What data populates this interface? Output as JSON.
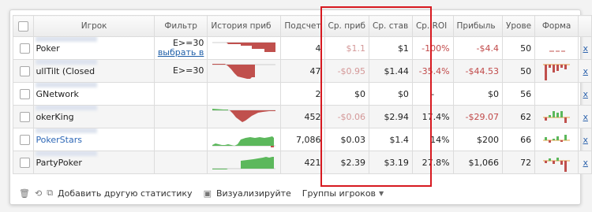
{
  "columns": {
    "player": "Игрок",
    "filter": "Фильтр",
    "history": "История приб",
    "hands": "Подсчет",
    "profit_bb": "Ср. приб",
    "avg_bet": "Ср. став",
    "avg_roi": "Ср. ROI",
    "profit": "Прибыль",
    "level": "Урове",
    "form": "Форма"
  },
  "rows": [
    {
      "player": "Poker",
      "filter_text": "E>=30",
      "filter_link": "выбрать в",
      "hands": "4",
      "profit_bb": "$1.1",
      "avg_bet": "$1",
      "avg_roi": "-100%",
      "profit": "-$4.4",
      "level": "50",
      "x": "x"
    },
    {
      "player": "ullTilt (Closed",
      "filter_text": "E>=30",
      "filter_link": "",
      "hands": "47",
      "profit_bb": "-$0.95",
      "avg_bet": "$1.44",
      "avg_roi": "-35.4%",
      "profit": "-$44.53",
      "level": "50",
      "x": "x"
    },
    {
      "player": "GNetwork",
      "filter_text": "",
      "filter_link": "",
      "hands": "2",
      "profit_bb": "$0",
      "avg_bet": "$0",
      "avg_roi": "-",
      "profit": "$0",
      "level": "56",
      "x": "x"
    },
    {
      "player": "okerKing",
      "filter_text": "",
      "filter_link": "",
      "hands": "452",
      "profit_bb": "-$0.06",
      "avg_bet": "$2.94",
      "avg_roi": "17.4%",
      "profit": "-$29.07",
      "level": "62",
      "x": "x"
    },
    {
      "player": "PokerStars",
      "filter_text": "",
      "filter_link": "",
      "hands": "7,086",
      "profit_bb": "$0.03",
      "avg_bet": "$1.4",
      "avg_roi": "14%",
      "profit": "$200",
      "level": "66",
      "x": "x"
    },
    {
      "player": "PartyPoker",
      "filter_text": "",
      "filter_link": "",
      "hands": "421",
      "profit_bb": "$2.39",
      "avg_bet": "$3.19",
      "avg_roi": "27.8%",
      "profit": "$1,066",
      "level": "72",
      "x": "x"
    }
  ],
  "footer": {
    "add_stats": "Добавить другую статистику",
    "visualize": "Визуализируйте",
    "groups": "Группы игроков"
  },
  "colors": {
    "loss": "#c0504d",
    "gain": "#5cb85c",
    "highlight": "#d71920"
  }
}
